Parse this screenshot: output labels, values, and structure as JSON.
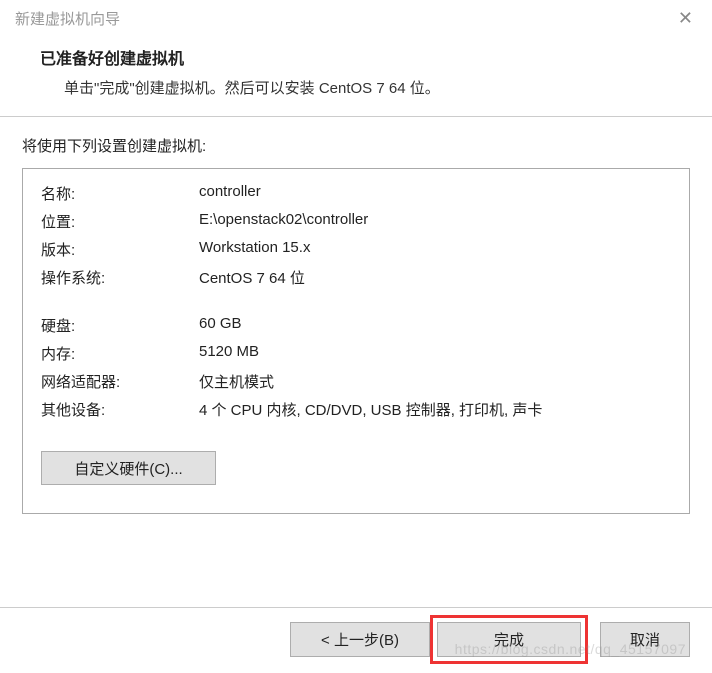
{
  "window": {
    "title": "新建虚拟机向导"
  },
  "header": {
    "title": "已准备好创建虚拟机",
    "subtitle": "单击\"完成\"创建虚拟机。然后可以安装 CentOS 7 64 位。"
  },
  "intro": "将使用下列设置创建虚拟机:",
  "settings": {
    "rows": [
      {
        "label": "名称:",
        "value": "controller"
      },
      {
        "label": "位置:",
        "value": "E:\\openstack02\\controller"
      },
      {
        "label": "版本:",
        "value": "Workstation 15.x"
      },
      {
        "label": "操作系统:",
        "value": "CentOS 7 64 位"
      }
    ],
    "rows2": [
      {
        "label": "硬盘:",
        "value": "60 GB"
      },
      {
        "label": "内存:",
        "value": "5120 MB"
      },
      {
        "label": "网络适配器:",
        "value": "仅主机模式"
      },
      {
        "label": "其他设备:",
        "value": "4 个 CPU 内核, CD/DVD, USB 控制器, 打印机, 声卡"
      }
    ]
  },
  "buttons": {
    "customize": "自定义硬件(C)...",
    "back": "< 上一步(B)",
    "finish": "完成",
    "cancel": "取消"
  },
  "watermark": "https://blog.csdn.net/qq_45157097"
}
